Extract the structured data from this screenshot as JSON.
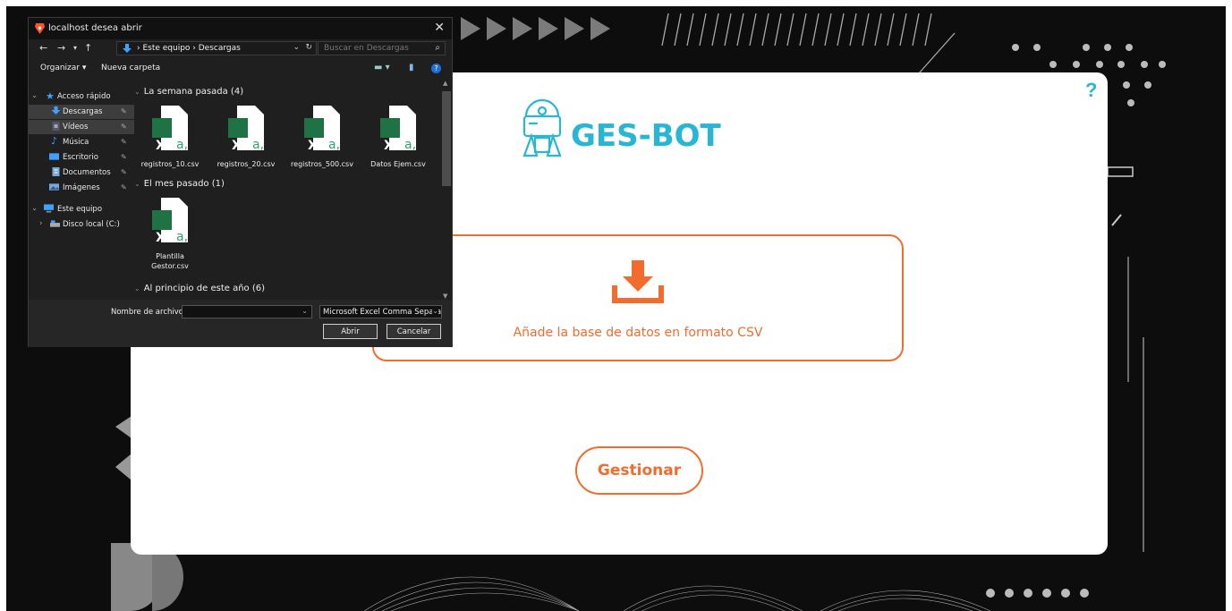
{
  "app": {
    "logo_text": "GES-BOT",
    "help_label": "?",
    "drop_label": "Añade la base de datos en formato CSV",
    "gestionar_label": "Gestionar",
    "colors": {
      "accent": "#f26c2e",
      "brand": "#29b6d6",
      "background": "#0d0d0d"
    }
  },
  "dialog": {
    "title": "localhost desea abrir",
    "close": "✕",
    "nav": {
      "back": "←",
      "forward": "→",
      "recent": "▾",
      "up": "↑",
      "refresh": "↻",
      "path_dropdown": "⌄"
    },
    "breadcrumb": "›  Este equipo  ›  Descargas",
    "search_placeholder": "Buscar en Descargas",
    "toolbar": {
      "organizar": "Organizar ▾",
      "nueva_carpeta": "Nueva carpeta",
      "view_label": "▬ ▾",
      "pane_label": "▮",
      "help_label": "?"
    },
    "sidebar": [
      {
        "label": "Acceso rápido",
        "icon": "star-icon",
        "expander": "⌄"
      },
      {
        "label": "Descargas",
        "icon": "download-folder-icon",
        "pin": "📌"
      },
      {
        "label": "Vídeos",
        "icon": "video-folder-icon",
        "pin": "📌"
      },
      {
        "label": "Música",
        "icon": "music-folder-icon",
        "pin": "📌"
      },
      {
        "label": "Escritorio",
        "icon": "desktop-folder-icon",
        "pin": "📌"
      },
      {
        "label": "Documentos",
        "icon": "documents-folder-icon",
        "pin": "📌"
      },
      {
        "label": "Imágenes",
        "icon": "pictures-folder-icon",
        "pin": "📌"
      },
      {
        "label": "Este equipo",
        "icon": "computer-icon",
        "expander": "⌄"
      },
      {
        "label": "Disco local (C:)",
        "icon": "drive-icon",
        "expander": "›"
      }
    ],
    "groups": [
      {
        "label": "La semana pasada (4)",
        "files": [
          "registros_10.csv",
          "registros_20.csv",
          "registros_500.csv",
          "Datos Ejem.csv"
        ]
      },
      {
        "label": "El mes pasado (1)",
        "files": [
          "Plantilla Gestor.csv"
        ]
      },
      {
        "label": "Al principio de este año (6)",
        "files": []
      }
    ],
    "group_chevron": "⌄",
    "file_icon_letters": {
      "x": "X",
      "a": "a,"
    },
    "scroll_arrows": {
      "up": "▲",
      "down": "▼"
    },
    "filename_label": "Nombre de archivo:",
    "filename_value": "",
    "filename_dropdown": "⌄",
    "filetype_value": "Microsoft Excel Comma Separa",
    "filetype_dropdown": "⌄",
    "open_button": "Abrir",
    "cancel_button": "Cancelar"
  }
}
